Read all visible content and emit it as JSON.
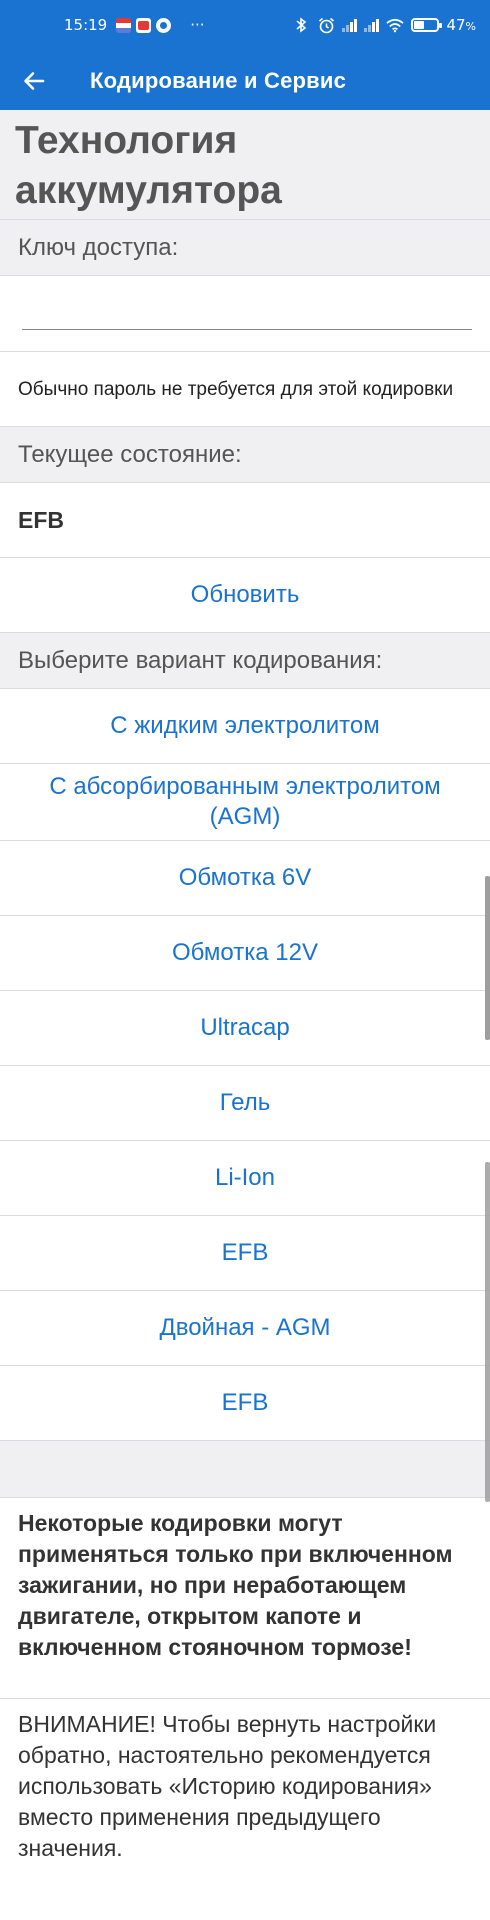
{
  "status_bar": {
    "time": "15:19",
    "more": "···",
    "battery_percent": "47",
    "battery_symbol": "%",
    "battery_level": 0.47
  },
  "app_bar": {
    "title": "Кодирование и Сервис"
  },
  "page": {
    "title": "Технология аккумулятора",
    "access_key_label": "Ключ доступа:",
    "access_key_value": "",
    "access_key_hint": "Обычно пароль не требуется для этой кодировки",
    "current_state_label": "Текущее состояние:",
    "current_state_value": "EFB",
    "refresh_button": "Обновить",
    "choose_variant_label": "Выберите вариант кодирования:",
    "options": [
      "С жидким электролитом",
      "С абсорбированным электролитом (AGM)",
      "Обмотка 6V",
      "Обмотка 12V",
      "Ultracap",
      "Гель",
      "Li-Ion",
      "EFB",
      "Двойная - AGM",
      "EFB"
    ],
    "warning_bold": "Некоторые кодировки могут применяться только при включенном зажигании, но при неработающем двигателе, открытом капоте и включенном стояночном тормозе!",
    "warning_text": "ВНИМАНИЕ! Чтобы вернуть настройки обратно, настоятельно рекомендуется использовать «Историю кодирования» вместо применения предыдущего значения."
  },
  "colors": {
    "accent": "#1a73d1",
    "background": "#f0f0f2"
  }
}
